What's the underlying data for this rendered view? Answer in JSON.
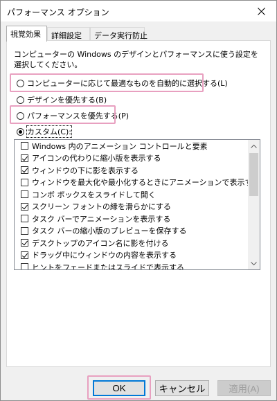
{
  "window": {
    "title": "パフォーマンス オプション"
  },
  "tabs": [
    {
      "label": "視覚効果"
    },
    {
      "label": "詳細設定"
    },
    {
      "label": "データ実行防止"
    }
  ],
  "visual_effects": {
    "intro": "コンピューターの Windows のデザインとパフォーマンスに使う設定を選択してください。",
    "options": [
      {
        "label": "コンピューターに応じて最適なものを自動的に選択する(L)",
        "checked": false
      },
      {
        "label": "デザインを優先する(B)",
        "checked": false
      },
      {
        "label": "パフォーマンスを優先する(P)",
        "checked": false
      },
      {
        "label": "カスタム(C):",
        "checked": true
      }
    ],
    "effects": [
      {
        "label": "Windows 内のアニメーション コントロールと要素",
        "checked": false
      },
      {
        "label": "アイコンの代わりに縮小版を表示する",
        "checked": true
      },
      {
        "label": "ウィンドウの下に影を表示する",
        "checked": true
      },
      {
        "label": "ウィンドウを最大化や最小化するときにアニメーションで表示する",
        "checked": false
      },
      {
        "label": "コンボ ボックスをスライドして開く",
        "checked": false
      },
      {
        "label": "スクリーン フォントの縁を滑らかにする",
        "checked": true
      },
      {
        "label": "タスク バーでアニメーションを表示する",
        "checked": false
      },
      {
        "label": "タスク バーの縮小版のプレビューを保存する",
        "checked": false
      },
      {
        "label": "デスクトップのアイコン名に影を付ける",
        "checked": true
      },
      {
        "label": "ドラッグ中にウィンドウの内容を表示する",
        "checked": true
      },
      {
        "label": "ヒントをフェードまたはスライドで表示する",
        "checked": false
      }
    ]
  },
  "buttons": {
    "ok": "OK",
    "cancel": "キャンセル",
    "apply": "適用(A)"
  },
  "highlight_color": "#e8a0c0"
}
